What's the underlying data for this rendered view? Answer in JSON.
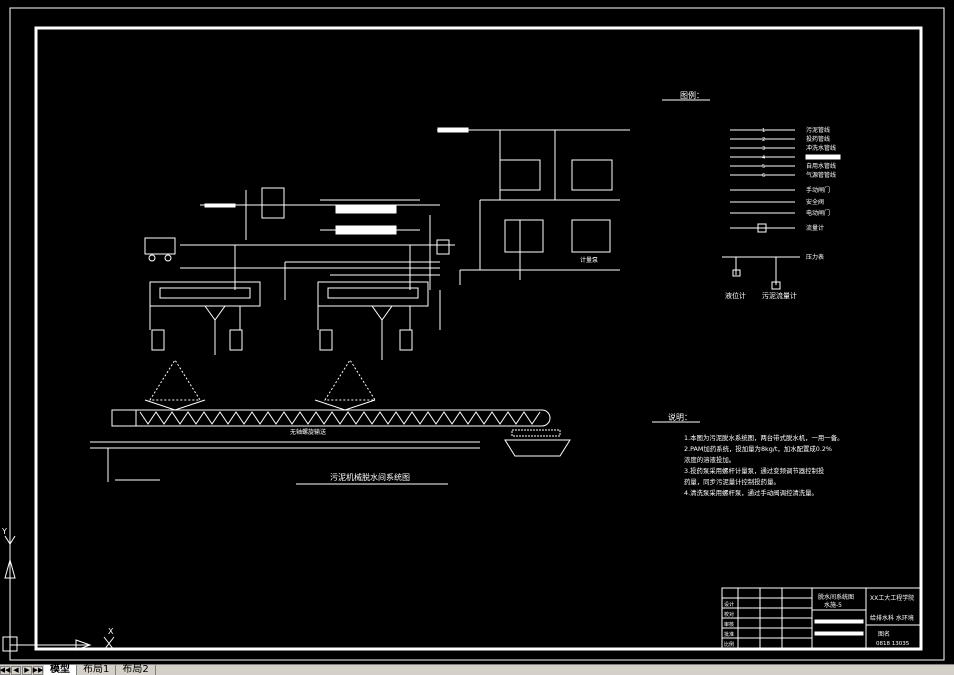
{
  "drawing": {
    "title": "污泥机械脱水间系统图",
    "legend": {
      "heading": "图例：",
      "lines": [
        {
          "num": "1",
          "label": "污泥管线"
        },
        {
          "num": "2",
          "label": "投药管线"
        },
        {
          "num": "3",
          "label": "冲洗水管线"
        },
        {
          "num": "4",
          "label": ""
        },
        {
          "num": "5",
          "label": "自用水管线"
        },
        {
          "num": "6",
          "label": "气源管管线"
        }
      ],
      "symbols": [
        "手动闸门",
        "安全阀",
        "电动闸门",
        "流量计",
        "压力表"
      ],
      "bottom": [
        "液位计",
        "污泥流量计"
      ]
    },
    "notes": {
      "heading": "说明：",
      "lines": [
        "1.本图为污泥脱水系统图，两台带式脱水机，一用一备。",
        "2.PAM加药系统，投加量为8kg/t，加水配置成0.2%",
        "浓度的溶液投加。",
        "3.投药泵采用螺杆计量泵，通过变频调节器控制投",
        "药量，同步污泥量计控制投药量。",
        "4.清洗泵采用螺杆泵，通过手动阀调控清洗量。"
      ]
    },
    "equipment_labels": {
      "screw": "无轴螺旋输送",
      "pump": "计量泵"
    },
    "title_block": {
      "drawing_name": "脱水间系统图",
      "drawing_no": "水施-5",
      "school": "XX工大工程学院",
      "project": "给排水科 水环境",
      "name": "图名",
      "number": "0818 13035",
      "row_labels": [
        "设计",
        "校对",
        "审核",
        "批准"
      ],
      "scale_label": "比例"
    }
  },
  "ucs": {
    "y_label": "Y",
    "x_label": "X"
  },
  "tabs": {
    "nav": [
      "◀◀",
      "◀",
      "▶",
      "▶▶"
    ],
    "items": [
      "模型",
      "布局1",
      "布局2"
    ],
    "active_index": 0
  }
}
